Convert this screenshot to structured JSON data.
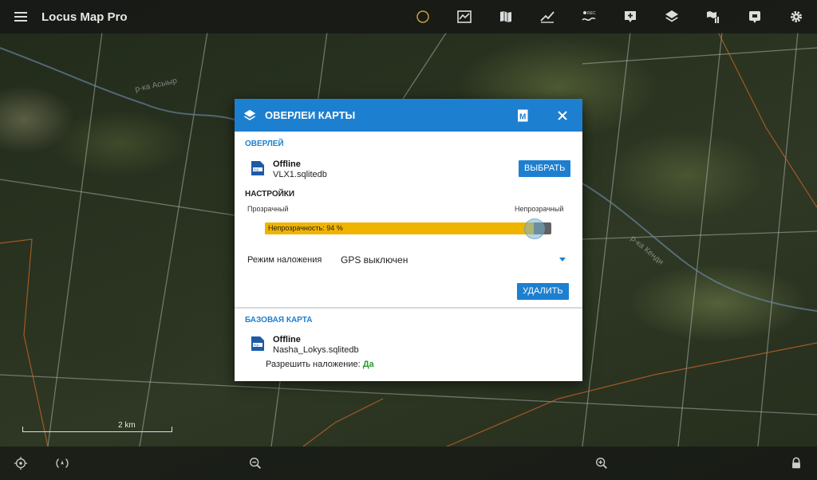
{
  "app": {
    "title": "Locus Map Pro"
  },
  "toolbar": {
    "icons": [
      "menu-icon",
      "compass-icon",
      "tracks-icon",
      "map-icon",
      "track-record-icon",
      "rec-icon",
      "add-point-icon",
      "layers-icon",
      "map-tools-icon",
      "guidance-icon",
      "settings-icon"
    ],
    "rec_label": "REC"
  },
  "map": {
    "scale_label": "2 km"
  },
  "dialog": {
    "title": "ОВЕРЛЕИ КАРТЫ",
    "m_badge": "M",
    "overlay_section": {
      "heading": "ОВЕРЛЕЙ",
      "type": "Offline",
      "file": "VLX1.sqlitedb",
      "select_button": "ВЫБРАТЬ"
    },
    "settings": {
      "heading": "НАСТРОЙКИ",
      "transparent_label": "Прозрачный",
      "opaque_label": "Непрозрачный",
      "opacity_text": "Непрозрачность: 94 %",
      "opacity_percent": 94,
      "blend_label": "Режим наложения",
      "blend_value": "GPS выключен",
      "delete_button": "УДАЛИТЬ"
    },
    "base_section": {
      "heading": "БАЗОВАЯ КАРТА",
      "type": "Offline",
      "file": "Nasha_Lokys.sqlitedb",
      "allow_label": "Разрешить наложение:",
      "allow_value": "Да"
    }
  },
  "colors": {
    "accent": "#1d7fd0",
    "slider": "#f0b400",
    "yes_green": "#2b9a2b"
  }
}
